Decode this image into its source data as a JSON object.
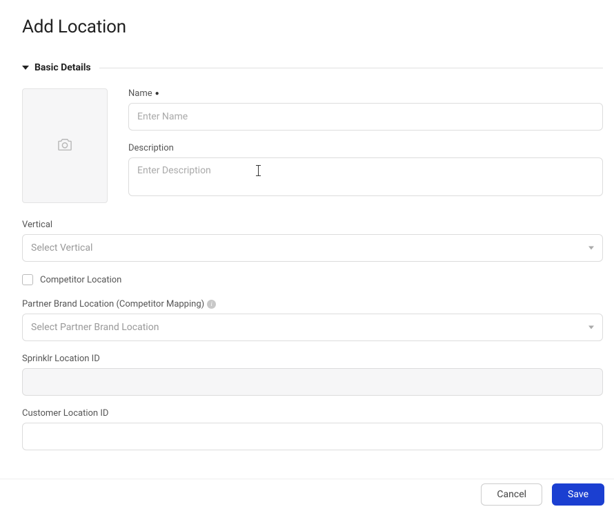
{
  "page": {
    "title": "Add Location"
  },
  "section": {
    "title": "Basic Details"
  },
  "fields": {
    "name": {
      "label": "Name",
      "placeholder": "Enter Name"
    },
    "description": {
      "label": "Description",
      "placeholder": "Enter Description"
    },
    "vertical": {
      "label": "Vertical",
      "placeholder": "Select Vertical"
    },
    "competitor": {
      "label": "Competitor Location"
    },
    "partner": {
      "label": "Partner Brand Location (Competitor Mapping)",
      "placeholder": "Select Partner Brand Location"
    },
    "sprinklr_id": {
      "label": "Sprinklr Location ID",
      "value": ""
    },
    "customer_id": {
      "label": "Customer Location ID",
      "value": ""
    }
  },
  "footer": {
    "cancel": "Cancel",
    "save": "Save"
  }
}
